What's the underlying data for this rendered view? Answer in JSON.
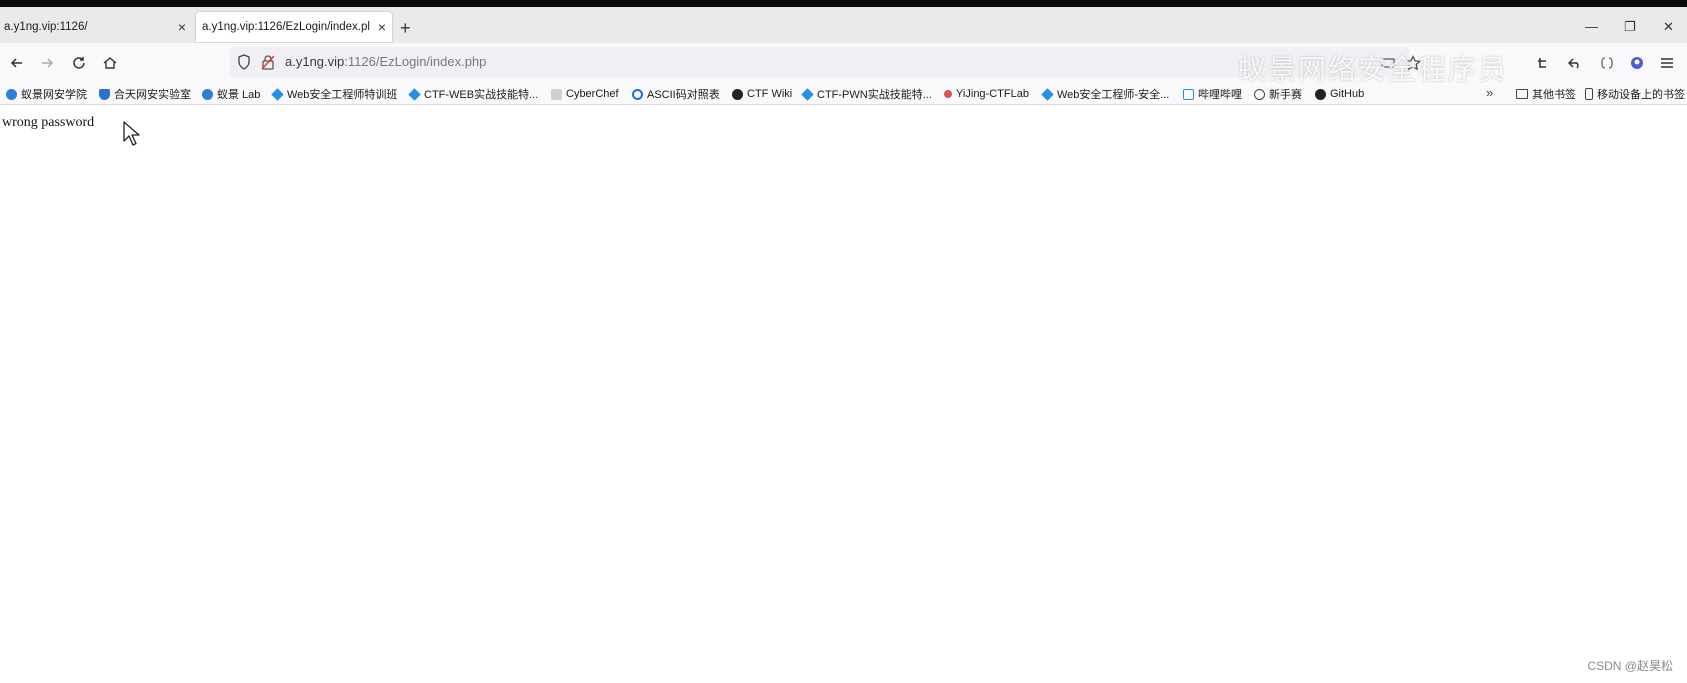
{
  "tabs": [
    {
      "title": "a.y1ng.vip:1126/",
      "close_icon": "×"
    },
    {
      "title": "a.y1ng.vip:1126/EzLogin/index.pl",
      "close_icon": "×"
    }
  ],
  "new_tab_glyph": "+",
  "window_controls": {
    "minimize": "—",
    "restore": "❐",
    "close": "✕"
  },
  "nav": {
    "back": "←",
    "forward": "→",
    "reload": "↻",
    "home": "⌂"
  },
  "url": {
    "host": "a.y1ng.vip",
    "rest": ":1126/EzLogin/index.php"
  },
  "watermark": "蚁景网络安全程序员",
  "bookmarks": [
    {
      "label": "蚁景网安学院",
      "icon": "blue"
    },
    {
      "label": "合天网安实验室",
      "icon": "shield"
    },
    {
      "label": "蚁景 Lab",
      "icon": "blue"
    },
    {
      "label": "Web安全工程师特训班",
      "icon": "diamond"
    },
    {
      "label": "CTF-WEB实战技能特...",
      "icon": "diamond"
    },
    {
      "label": "CyberChef",
      "icon": "gray"
    },
    {
      "label": "ASCII码对照表",
      "icon": "ring"
    },
    {
      "label": "CTF Wiki",
      "icon": "black"
    },
    {
      "label": "CTF-PWN实战技能特...",
      "icon": "diamond"
    },
    {
      "label": "YiJing-CTFLab",
      "icon": "red"
    },
    {
      "label": "Web安全工程师-安全...",
      "icon": "diamond"
    },
    {
      "label": "哔哩哔哩",
      "icon": "tv"
    },
    {
      "label": "新手赛",
      "icon": "globe"
    },
    {
      "label": "GitHub",
      "icon": "black"
    }
  ],
  "bookmarks_more": "»",
  "other_bookmarks": "其他书签",
  "mobile_bookmarks": "移动设备上的书签",
  "page_message": "wrong password",
  "footer_watermark": "CSDN @赵昊松"
}
